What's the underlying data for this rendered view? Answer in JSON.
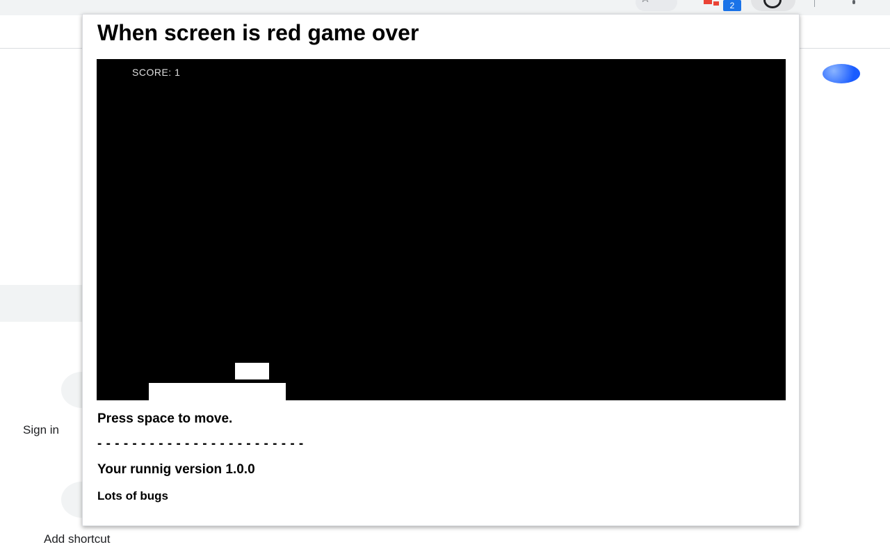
{
  "browser": {
    "extension_badge": "2",
    "background_page": {
      "signin_label": "Sign in",
      "add_shortcut_label": "Add shortcut"
    }
  },
  "popup": {
    "title": "When screen is red game over",
    "game": {
      "score_text": "SCORE: 1",
      "background_color": "#000000",
      "entity_color": "#ffffff"
    },
    "instruction": "Press space to move.",
    "separator": "- - - - - - - - - - - - - - - - - - - - - - - -",
    "version_text": "Your runnig version 1.0.0",
    "bugs_note": "Lots of bugs"
  },
  "icons": [
    "star-icon",
    "extension-icon",
    "active-extension-icon",
    "menu-icon",
    "profile-avatar"
  ]
}
